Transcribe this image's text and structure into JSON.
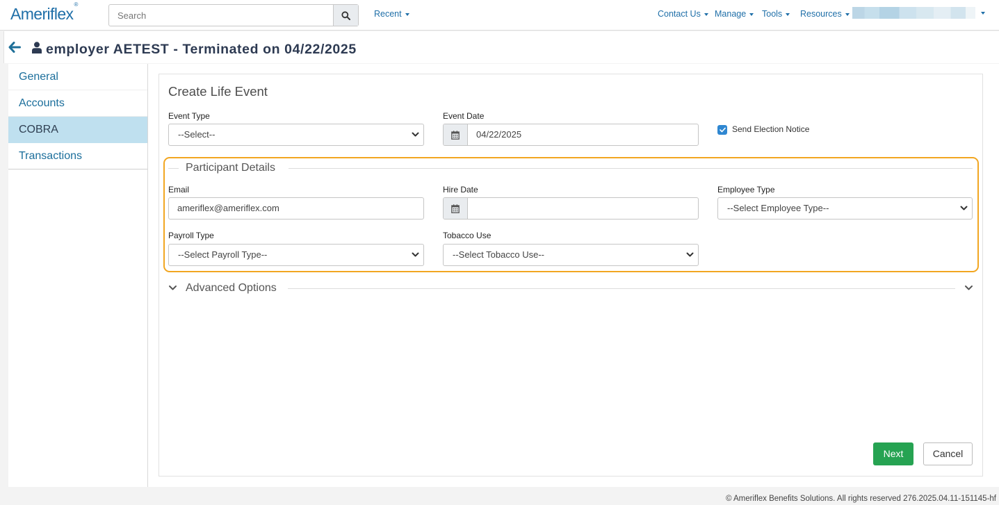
{
  "brand": {
    "name": "Ameriflex",
    "mark": "®"
  },
  "search": {
    "placeholder": "Search"
  },
  "nav": {
    "recent": "Recent",
    "contact_us": "Contact Us",
    "manage": "Manage",
    "tools": "Tools",
    "resources": "Resources"
  },
  "header": {
    "title": "employer AETEST - Terminated on 04/22/2025"
  },
  "sidebar": {
    "items": [
      {
        "label": "General"
      },
      {
        "label": "Accounts"
      },
      {
        "label": "COBRA",
        "active": true
      },
      {
        "label": "Transactions"
      }
    ]
  },
  "form": {
    "title": "Create Life Event",
    "event_type": {
      "label": "Event Type",
      "value": "--Select--"
    },
    "event_date": {
      "label": "Event Date",
      "value": "04/22/2025"
    },
    "send_notice": {
      "label": "Send Election Notice",
      "checked": true
    },
    "participant": {
      "legend": "Participant Details",
      "email": {
        "label": "Email",
        "value": "ameriflex@ameriflex.com"
      },
      "hire_date": {
        "label": "Hire Date",
        "value": ""
      },
      "employee_type": {
        "label": "Employee Type",
        "value": "--Select Employee Type--"
      },
      "payroll_type": {
        "label": "Payroll Type",
        "value": "--Select Payroll Type--"
      },
      "tobacco_use": {
        "label": "Tobacco Use",
        "value": "--Select Tobacco Use--"
      }
    },
    "advanced": {
      "legend": "Advanced Options"
    },
    "buttons": {
      "next": "Next",
      "cancel": "Cancel"
    }
  },
  "footer": {
    "text": "© Ameriflex Benefits Solutions. All rights reserved 276.2025.04.11-151145-hf"
  },
  "colors": {
    "brand_blue": "#1f6fa8",
    "active_tab_bg": "#bfe0ef",
    "highlight_orange": "#f2a621",
    "next_green": "#26a352",
    "checkbox_blue": "#2f87d1"
  }
}
